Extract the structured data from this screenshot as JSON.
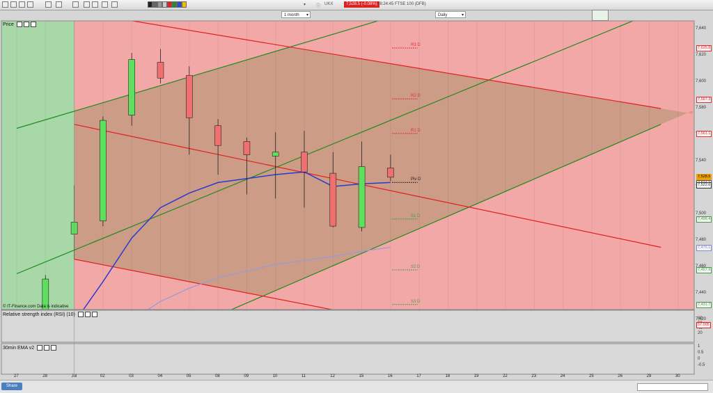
{
  "toolbar": {
    "symbol": "UKX",
    "price_badge": "7,528.5 (-0.08%)",
    "info": "08:24:45 FTSE 100 (DFB)",
    "period_select": "1 month",
    "interval_select": "Daily"
  },
  "panels": {
    "price_title": "Price",
    "rsi_title": "Relative strength index (RSI) (10)",
    "ema_title": "30min EMA v2",
    "watermark": "© IT-Finance.com Data is indicative"
  },
  "share_label": "Share",
  "x_ticks": [
    "27",
    "28",
    "Jul",
    "02",
    "03",
    "04",
    "05",
    "08",
    "09",
    "10",
    "11",
    "12",
    "15",
    "16",
    "17",
    "18",
    "19",
    "22",
    "23",
    "24",
    "25",
    "26",
    "29",
    "30"
  ],
  "y_ticks": [
    "7,640",
    "7,620",
    "7,600",
    "7,580",
    "7,560",
    "7,540",
    "7,520",
    "7,500",
    "7,480",
    "7,460",
    "7,440",
    "7,420"
  ],
  "price_tags": [
    {
      "text": "7,625.8",
      "value": 7625.8,
      "color": "#e03030"
    },
    {
      "text": "7,587.3",
      "value": 7587.3,
      "color": "#e03030"
    },
    {
      "text": "7,561.1",
      "value": 7561.1,
      "color": "#e03030"
    },
    {
      "text": "7,528.5",
      "value": 7528.5,
      "color": "#f0a000"
    },
    {
      "text": "7,524.1",
      "value": 7524.1,
      "color": "#555555"
    },
    {
      "text": "7,522.6",
      "value": 7522.6,
      "color": "#333333"
    },
    {
      "text": "7,496.4",
      "value": 7496.4,
      "color": "#4a9a4a"
    },
    {
      "text": "7,475.1",
      "value": 7475.1,
      "color": "#8888cc"
    },
    {
      "text": "7,457.9",
      "value": 7457.9,
      "color": "#4a9a4a"
    },
    {
      "text": "7,431.7",
      "value": 7431.7,
      "color": "#4a9a4a"
    }
  ],
  "pivots": [
    {
      "label": "R3 D",
      "value": 7625.8,
      "color": "#e03030"
    },
    {
      "label": "R2 D",
      "value": 7587.3,
      "color": "#e03030"
    },
    {
      "label": "R1 D",
      "value": 7561.1,
      "color": "#e03030"
    },
    {
      "label": "Piv D",
      "value": 7524.1,
      "color": "#222222"
    },
    {
      "label": "S1 D",
      "value": 7496.4,
      "color": "#4a9a4a"
    },
    {
      "label": "S2 D",
      "value": 7457.9,
      "color": "#4a9a4a"
    },
    {
      "label": "S3 D",
      "value": 7431.7,
      "color": "#4a9a4a"
    }
  ],
  "rsi_ticks": [
    "80",
    "60",
    "40",
    "20"
  ],
  "rsi_value_tag": "57.005",
  "ema_ticks": [
    "1",
    "0.5",
    "0",
    "-0.5"
  ],
  "chart_data": {
    "type": "candlestick",
    "title": "",
    "categories": [
      "27",
      "28",
      "Jul",
      "02",
      "03",
      "04",
      "05",
      "08",
      "09",
      "10",
      "11",
      "12",
      "15",
      "16"
    ],
    "ylim": [
      7400,
      7650
    ],
    "candles": [
      {
        "x": "27",
        "open": 7410,
        "high": 7419,
        "low": 7403,
        "close": 7418
      },
      {
        "x": "28",
        "open": 7418,
        "high": 7454,
        "low": 7404,
        "close": 7451
      },
      {
        "x": "Jul",
        "open": 7485,
        "high": 7522,
        "low": 7466,
        "close": 7494
      },
      {
        "x": "02",
        "open": 7495,
        "high": 7574,
        "low": 7491,
        "close": 7571
      },
      {
        "x": "03",
        "open": 7575,
        "high": 7622,
        "low": 7567,
        "close": 7617
      },
      {
        "x": "04",
        "open": 7615,
        "high": 7625,
        "low": 7599,
        "close": 7603
      },
      {
        "x": "05",
        "open": 7605,
        "high": 7612,
        "low": 7545,
        "close": 7573
      },
      {
        "x": "08",
        "open": 7567,
        "high": 7572,
        "low": 7530,
        "close": 7552
      },
      {
        "x": "09",
        "open": 7555,
        "high": 7558,
        "low": 7515,
        "close": 7545
      },
      {
        "x": "10",
        "open": 7544,
        "high": 7562,
        "low": 7512,
        "close": 7547
      },
      {
        "x": "11",
        "open": 7547,
        "high": 7563,
        "low": 7505,
        "close": 7532
      },
      {
        "x": "12",
        "open": 7531,
        "high": 7547,
        "low": 7490,
        "close": 7491
      },
      {
        "x": "15",
        "open": 7490,
        "high": 7555,
        "low": 7487,
        "close": 7536
      },
      {
        "x": "16",
        "open": 7535,
        "high": 7545,
        "low": 7525,
        "close": 7528
      }
    ],
    "ema_fast": [
      7390,
      7400,
      7418,
      7449,
      7482,
      7505,
      7516,
      7524,
      7527,
      7530,
      7532,
      7521,
      7523,
      7524
    ],
    "ema_slow": [
      7370,
      7380,
      7390,
      7402,
      7420,
      7434,
      7444,
      7452,
      7457,
      7462,
      7465,
      7468,
      7472,
      7475
    ],
    "rsi": [
      50,
      51,
      53,
      55,
      57,
      56,
      54,
      52,
      52,
      53,
      51,
      48,
      54,
      54
    ],
    "channels": {
      "green_upper": [
        {
          "x": 0,
          "y": 7565
        },
        {
          "x": 22.4,
          "y": 7710
        }
      ],
      "green_mid": [
        {
          "x": 0,
          "y": 7455
        },
        {
          "x": 22.4,
          "y": 7655
        }
      ],
      "green_lower": [
        {
          "x": 4.5,
          "y": 7400
        },
        {
          "x": 22.4,
          "y": 7568
        }
      ],
      "red_upper": [
        {
          "x": 3.0,
          "y": 7650
        },
        {
          "x": 22.4,
          "y": 7580
        }
      ],
      "red_mid": [
        {
          "x": 2.0,
          "y": 7568
        },
        {
          "x": 22.4,
          "y": 7475
        }
      ],
      "red_lower": [
        {
          "x": 2.0,
          "y": 7466
        },
        {
          "x": 17.5,
          "y": 7400
        }
      ]
    }
  }
}
